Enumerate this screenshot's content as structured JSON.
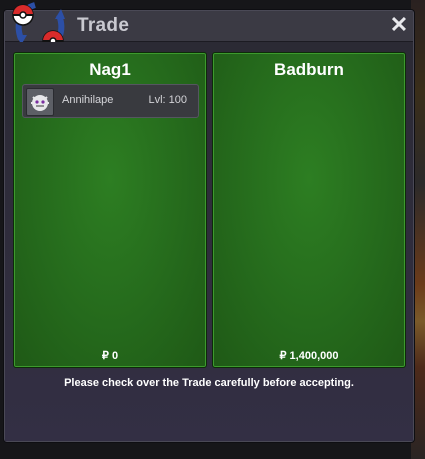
{
  "window": {
    "title": "Trade",
    "close_glyph": "✕"
  },
  "trade": {
    "left": {
      "player_name": "Nag1",
      "money": "₽ 0",
      "items": [
        {
          "name": "Annihilape",
          "level": "Lvl: 100",
          "icon": "annihilape-sprite-icon"
        }
      ]
    },
    "right": {
      "player_name": "Badburn",
      "money": "₽ 1,400,000",
      "items": []
    }
  },
  "notice": "Please check over the Trade carefully before accepting.",
  "colors": {
    "panel_green": "#256a1c",
    "window_bg": "#2c2b35",
    "titlebar": "#3b3a44"
  }
}
